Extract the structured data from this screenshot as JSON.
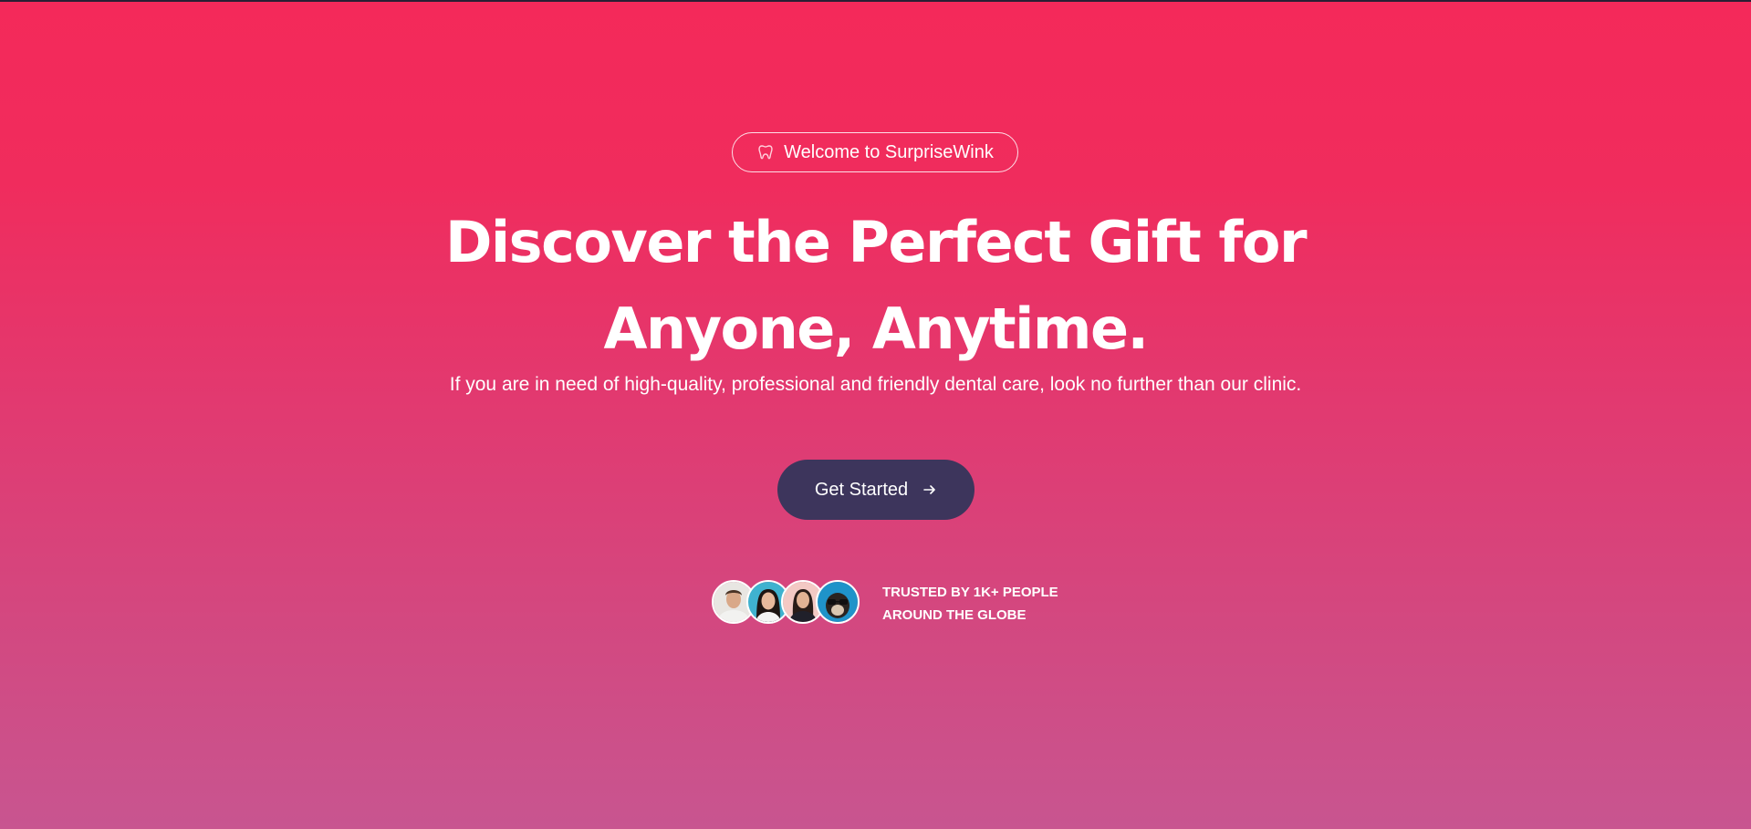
{
  "hero": {
    "badge": {
      "icon": "tooth-icon",
      "text": "Welcome to SurpriseWink"
    },
    "headline": {
      "line1": "Discover the Perfect Gift for",
      "line2": "Anyone, Anytime."
    },
    "subtext": "If you are in need of high-quality, professional and friendly dental care, look no further than our clinic.",
    "cta": {
      "label": "Get Started",
      "icon": "arrow-right-icon"
    },
    "trust": {
      "line1": "TRUSTED BY 1K+ PEOPLE",
      "line2": "AROUND THE GLOBE",
      "avatars": [
        "avatar-man",
        "avatar-woman-smiling",
        "avatar-woman",
        "avatar-dog-sunglasses"
      ]
    }
  },
  "colors": {
    "gradient_top": "#f4295a",
    "gradient_bottom": "#c85590",
    "cta_background": "#3d355c",
    "text": "#ffffff"
  }
}
